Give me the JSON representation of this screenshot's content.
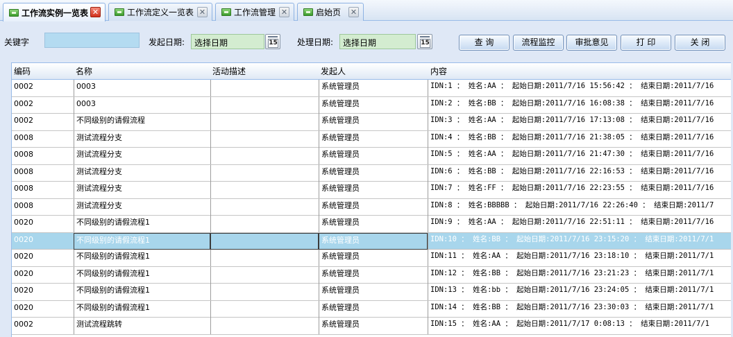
{
  "tabs": [
    {
      "label": "工作流实例一览表",
      "active": true
    },
    {
      "label": "工作流定义一览表",
      "active": false
    },
    {
      "label": "工作流管理",
      "active": false
    },
    {
      "label": "启始页",
      "active": false
    }
  ],
  "toolbar": {
    "keyword_label": "关键字",
    "keyword_value": "",
    "start_date_label": "发起日期:",
    "start_date_value": "选择日期",
    "handle_date_label": "处理日期:",
    "handle_date_value": "选择日期",
    "calendar_day": "15",
    "buttons": [
      "查  询",
      "流程监控",
      "审批意见",
      "打  印",
      "关  闭"
    ]
  },
  "grid": {
    "columns": [
      "编码",
      "名称",
      "活动描述",
      "发起人",
      "内容"
    ],
    "rows": [
      [
        "0002",
        "0003",
        "",
        "系统管理员",
        "IDN:1  ：  姓名:AA  ：  起始日期:2011/7/16 15:56:42  ：  结束日期:2011/7/16"
      ],
      [
        "0002",
        "0003",
        "",
        "系统管理员",
        "IDN:2  ：  姓名:BB  ：  起始日期:2011/7/16 16:08:38  ：  结束日期:2011/7/16"
      ],
      [
        "0002",
        "不同级别的请假流程",
        "",
        "系统管理员",
        "IDN:3  ：  姓名:AA  ：  起始日期:2011/7/16 17:13:08  ：  结束日期:2011/7/16"
      ],
      [
        "0008",
        "测试流程分支",
        "",
        "系统管理员",
        "IDN:4  ：  姓名:BB  ：  起始日期:2011/7/16 21:38:05  ：  结束日期:2011/7/16"
      ],
      [
        "0008",
        "测试流程分支",
        "",
        "系统管理员",
        "IDN:5  ：  姓名:AA  ：  起始日期:2011/7/16 21:47:30  ：  结束日期:2011/7/16"
      ],
      [
        "0008",
        "测试流程分支",
        "",
        "系统管理员",
        "IDN:6  ：  姓名:BB  ：  起始日期:2011/7/16 22:16:53  ：  结束日期:2011/7/16"
      ],
      [
        "0008",
        "测试流程分支",
        "",
        "系统管理员",
        "IDN:7  ：  姓名:FF  ：  起始日期:2011/7/16 22:23:55  ：  结束日期:2011/7/16"
      ],
      [
        "0008",
        "测试流程分支",
        "",
        "系统管理员",
        "IDN:8  ：  姓名:BBBBB  ：  起始日期:2011/7/16 22:26:40  ：  结束日期:2011/7"
      ],
      [
        "0020",
        "不同级别的请假流程1",
        "",
        "系统管理员",
        "IDN:9  ：  姓名:AA  ：  起始日期:2011/7/16 22:51:11  ：  结束日期:2011/7/16"
      ],
      [
        "0020",
        "不同级别的请假流程1",
        "",
        "系统管理员",
        "IDN:10  ：  姓名:BB  ：  起始日期:2011/7/16 23:15:20  ：  结束日期:2011/7/1"
      ],
      [
        "0020",
        "不同级别的请假流程1",
        "",
        "系统管理员",
        "IDN:11  ：  姓名:AA  ：  起始日期:2011/7/16 23:18:10  ：  结束日期:2011/7/1"
      ],
      [
        "0020",
        "不同级别的请假流程1",
        "",
        "系统管理员",
        "IDN:12  ：  姓名:BB  ：  起始日期:2011/7/16 23:21:23  ：  结束日期:2011/7/1"
      ],
      [
        "0020",
        "不同级别的请假流程1",
        "",
        "系统管理员",
        "IDN:13  ：  姓名:bb  ：  起始日期:2011/7/16 23:24:05  ：  结束日期:2011/7/1"
      ],
      [
        "0020",
        "不同级别的请假流程1",
        "",
        "系统管理员",
        "IDN:14  ：  姓名:BB  ：  起始日期:2011/7/16 23:30:03  ：  结束日期:2011/7/1"
      ],
      [
        "0002",
        "测试流程跳转",
        "",
        "系统管理员",
        "IDN:15  ：  姓名:AA  ：  起始日期:2011/7/17 0:08:13  ：  结束日期:2011/7/1"
      ]
    ],
    "selected_row": 9
  },
  "colors": {
    "background": "#dfe8f6",
    "selected_row": "#a8d6ec",
    "date_field": "#d3ecd0",
    "keyword_field": "#b4dbf1",
    "active_tab_close": "#d0311c"
  }
}
